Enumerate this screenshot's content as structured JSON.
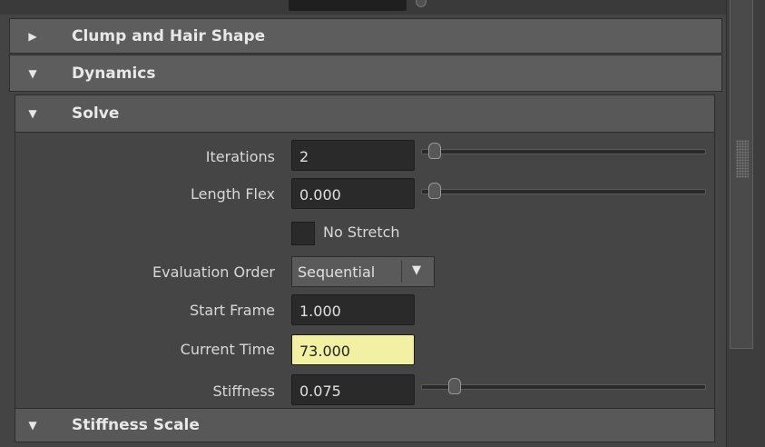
{
  "sections": {
    "clump_and_hair_shape": "Clump and Hair Shape",
    "dynamics": "Dynamics",
    "solve": "Solve",
    "stiffness_scale": "Stiffness Scale"
  },
  "fields": {
    "iterations": {
      "label": "Iterations",
      "value": "2",
      "slider_level": 0.0
    },
    "length_flex": {
      "label": "Length Flex",
      "value": "0.000",
      "slider_level": 0.0
    },
    "no_stretch": {
      "label": "No Stretch",
      "checked": false
    },
    "evaluation_order": {
      "label": "Evaluation Order",
      "value": "Sequential"
    },
    "start_frame": {
      "label": "Start Frame",
      "value": "1.000"
    },
    "current_time": {
      "label": "Current Time",
      "value": "73.000"
    },
    "stiffness": {
      "label": "Stiffness",
      "value": "0.075",
      "slider_level": 0.075
    }
  },
  "colors": {
    "keyed_field": "#f2f0a3",
    "panel_bg": "#454545",
    "header_bg": "#5d5d5d"
  }
}
